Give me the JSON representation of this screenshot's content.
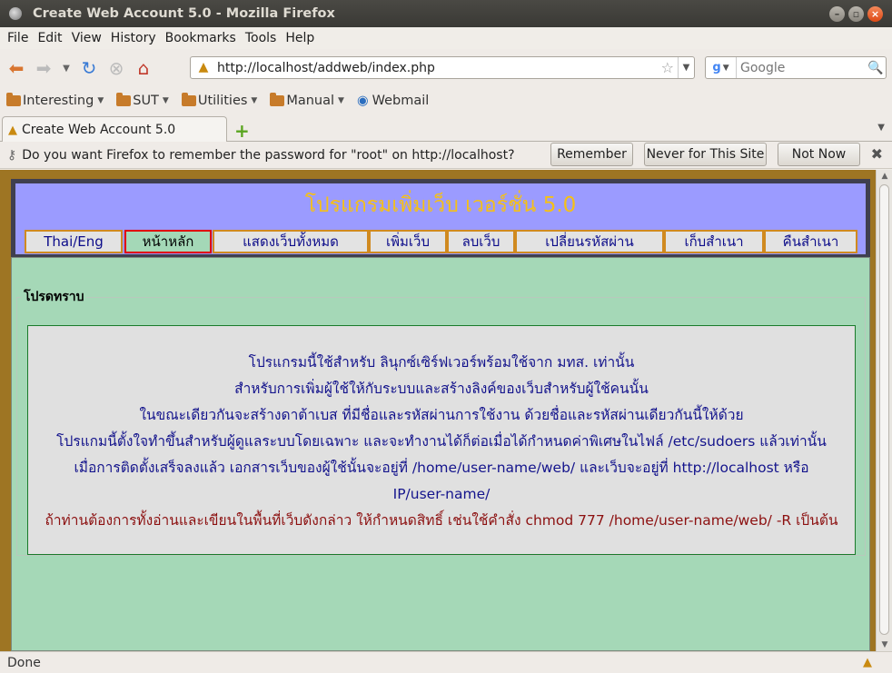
{
  "window": {
    "title": "Create Web Account 5.0 - Mozilla Firefox"
  },
  "menu": [
    "File",
    "Edit",
    "View",
    "History",
    "Bookmarks",
    "Tools",
    "Help"
  ],
  "toolbar": {
    "url": "http://localhost/addweb/index.php",
    "search_placeholder": "Google"
  },
  "bookmarks": [
    {
      "label": "Interesting",
      "type": "folder"
    },
    {
      "label": "SUT",
      "type": "folder"
    },
    {
      "label": "Utilities",
      "type": "folder"
    },
    {
      "label": "Manual",
      "type": "folder"
    },
    {
      "label": "Webmail",
      "type": "link"
    }
  ],
  "tab": {
    "title": "Create Web Account 5.0"
  },
  "notification": {
    "message": "Do you want Firefox to remember the password for \"root\" on http://localhost?",
    "remember": "Remember",
    "never": "Never for This Site",
    "not_now": "Not Now"
  },
  "page": {
    "title": "โปรแกรมเพิ่มเว็บ เวอร์ชั่น 5.0",
    "nav": [
      {
        "label": "Thai/Eng",
        "active": false
      },
      {
        "label": "หน้าหลัก",
        "active": true
      },
      {
        "label": "แสดงเว็บทั้งหมด",
        "active": false
      },
      {
        "label": "เพิ่มเว็บ",
        "active": false
      },
      {
        "label": "ลบเว็บ",
        "active": false
      },
      {
        "label": "เปลี่ยนรหัสผ่าน",
        "active": false
      },
      {
        "label": "เก็บสำเนา",
        "active": false
      },
      {
        "label": "คืนสำเนา",
        "active": false
      }
    ],
    "notice_legend": "โปรดทราบ",
    "notice_lines": [
      "โปรแกรมนี้ใช้สำหรับ ลินุกซ์เซิร์ฟเวอร์พร้อมใช้จาก มทส. เท่านั้น",
      "สำหรับการเพิ่มผู้ใช้ให้กับระบบและสร้างลิงค์ของเว็บสำหรับผู้ใช้คนนั้น",
      "ในขณะเดียวกันจะสร้างดาต้าเบส ที่มีชื่อและรหัสผ่านการใช้งาน ด้วยชื่อและรหัสผ่านเดียวกันนี้ให้ด้วย",
      "โปรแกมนี้ตั้งใจทำขึ้นสำหรับผู้ดูแลระบบโดยเฉพาะ และจะทำงานได้ก็ต่อเมื่อได้กำหนดค่าพิเศษในไฟล์ /etc/sudoers แล้วเท่านั้น",
      "เมื่อการติดตั้งเสร็จลงแล้ว เอกสารเว็บของผู้ใช้นั้นจะอยู่ที่ /home/user-name/web/ และเว็บจะอยู่ที่ http://localhost หรือ",
      "IP/user-name/"
    ],
    "notice_warning": "ถ้าท่านต้องการทั้งอ่านและเขียนในพื้นที่เว็บดังกล่าว ให้กำหนดสิทธิ์ เช่นใช้คำสั่ง chmod 777 /home/user-name/web/ -R เป็นต้น"
  },
  "status": {
    "text": "Done"
  },
  "colors": {
    "header_bg": "#9b9bff",
    "header_text": "#f5c016",
    "content_bg": "#a5d8b7",
    "frame_bg": "#9e7523",
    "active_border": "#e00000"
  }
}
